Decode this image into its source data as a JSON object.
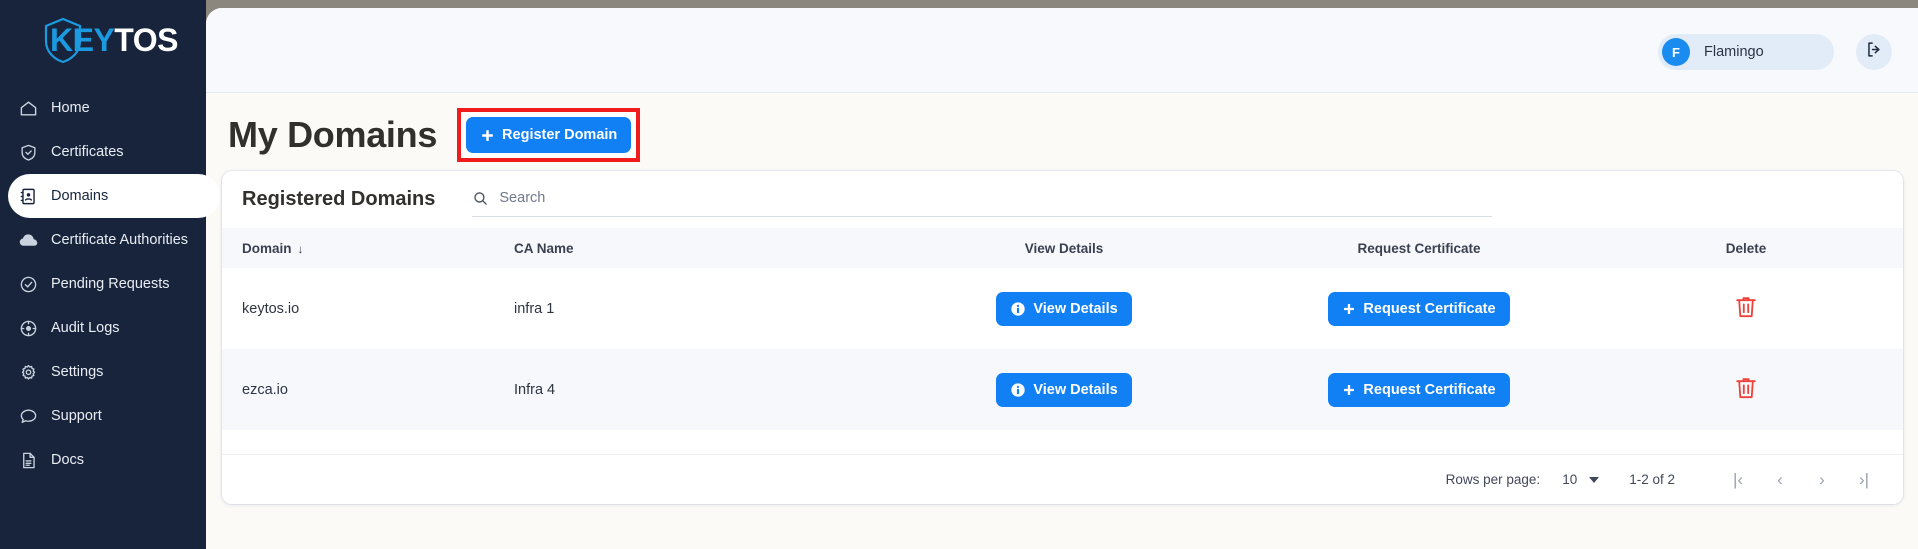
{
  "brand": {
    "name_part1": "KEY",
    "name_part2": "TOS",
    "logo_icon": "shield-icon"
  },
  "sidebar": {
    "items": [
      {
        "label": "Home",
        "icon": "home-icon",
        "active": false
      },
      {
        "label": "Certificates",
        "icon": "shield-check-icon",
        "active": false
      },
      {
        "label": "Domains",
        "icon": "address-book-icon",
        "active": true
      },
      {
        "label": "Certificate Authorities",
        "icon": "cloud-icon",
        "active": false
      },
      {
        "label": "Pending Requests",
        "icon": "check-circle-icon",
        "active": false
      },
      {
        "label": "Audit Logs",
        "icon": "target-icon",
        "active": false
      },
      {
        "label": "Settings",
        "icon": "gear-icon",
        "active": false
      },
      {
        "label": "Support",
        "icon": "chat-bubble-icon",
        "active": false
      },
      {
        "label": "Docs",
        "icon": "document-icon",
        "active": false
      }
    ]
  },
  "topbar": {
    "user": {
      "name": "Flamingo",
      "initial": "F",
      "avatar_color": "#1a8cf0"
    },
    "logout_icon": "logout-icon"
  },
  "page": {
    "title": "My Domains",
    "register_button": {
      "label": "Register Domain",
      "icon": "plus-icon"
    },
    "highlight_color": "#f01c1c"
  },
  "card": {
    "title": "Registered Domains",
    "search": {
      "placeholder": "Search",
      "value": "",
      "icon": "search-icon"
    },
    "table": {
      "columns": [
        {
          "label": "Domain",
          "sort_arrow": "↓"
        },
        {
          "label": "CA Name",
          "sort_arrow": ""
        },
        {
          "label": "View Details",
          "sort_arrow": ""
        },
        {
          "label": "Request Certificate",
          "sort_arrow": ""
        },
        {
          "label": "Delete",
          "sort_arrow": ""
        }
      ],
      "rows": [
        {
          "domain": "keytos.io",
          "ca_name": "infra 1",
          "view_label": "View Details",
          "request_label": "Request Certificate",
          "delete_icon": "trash-icon"
        },
        {
          "domain": "ezca.io",
          "ca_name": "Infra 4",
          "view_label": "View Details",
          "request_label": "Request Certificate",
          "delete_icon": "trash-icon"
        }
      ]
    },
    "pagination": {
      "rows_per_page_label": "Rows per page:",
      "rows_per_page_value": "10",
      "range": "1-2 of 2",
      "first_label": "|‹",
      "prev_label": "‹",
      "next_label": "›",
      "last_label": "›|"
    }
  },
  "colors": {
    "sidebar_bg": "#17243c",
    "accent_blue": "#1180f5",
    "danger_red": "#f0403a",
    "highlight_red": "#f01c1c"
  }
}
